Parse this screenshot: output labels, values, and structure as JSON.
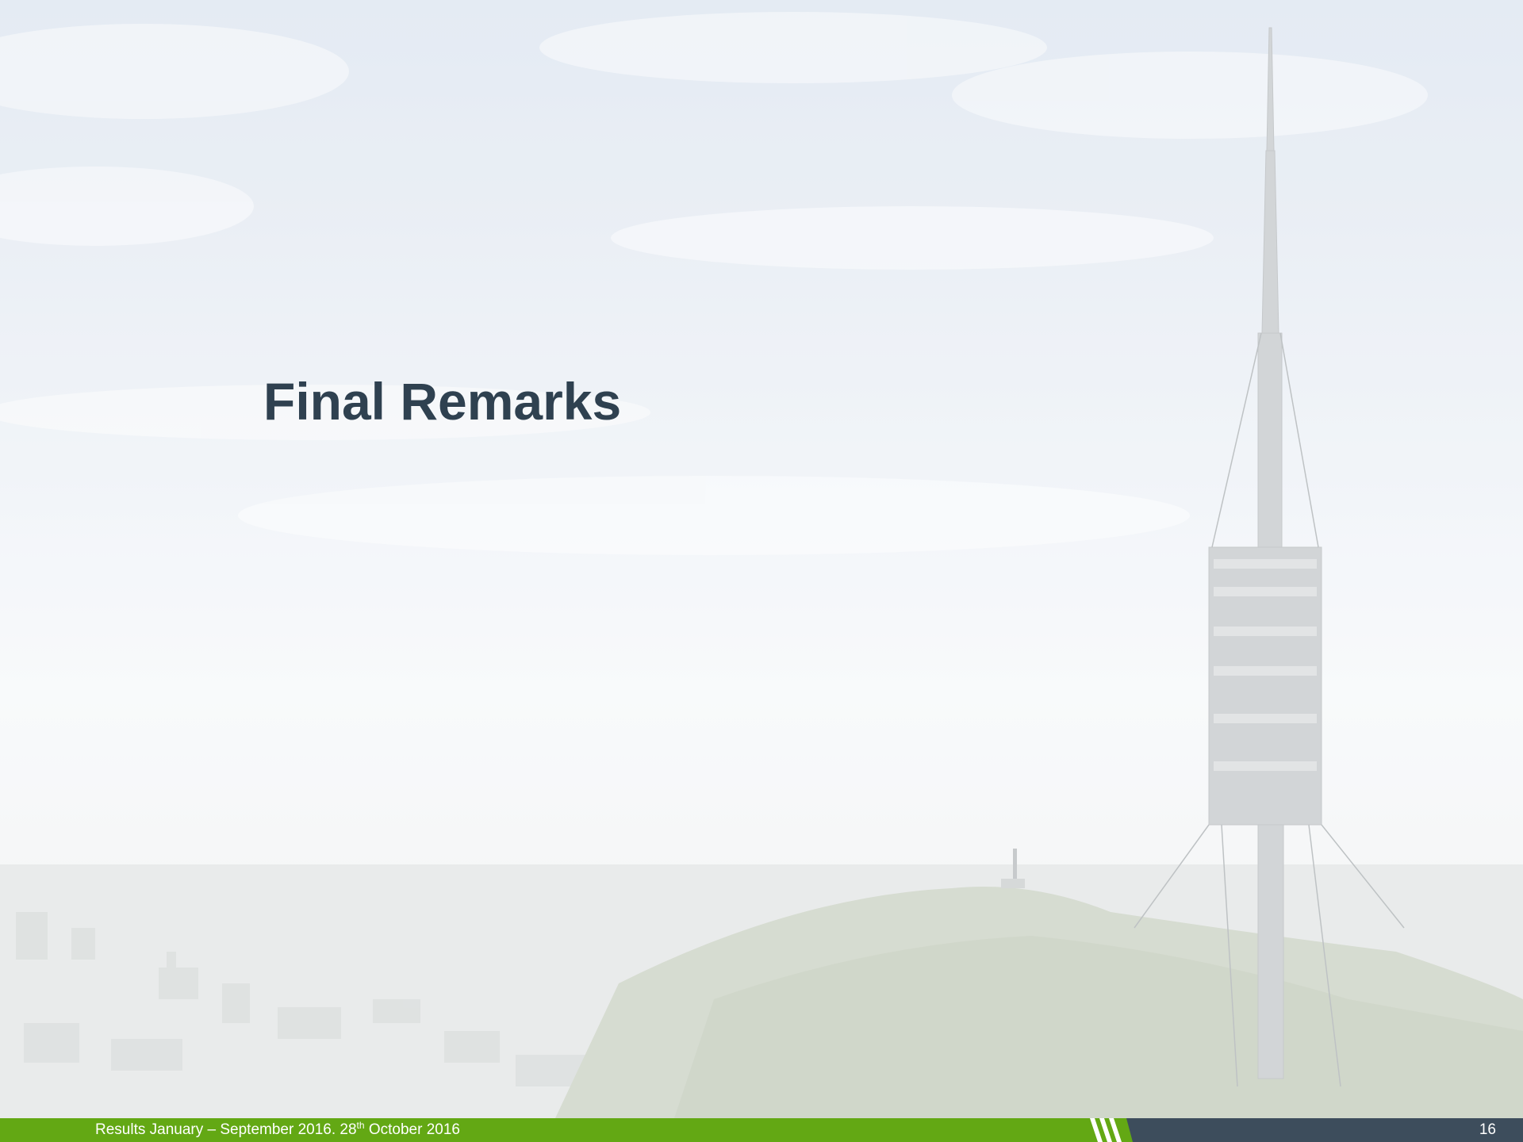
{
  "slide": {
    "title": "Final Remarks"
  },
  "footer": {
    "text_before_sup": "Results January – September 2016. 28",
    "sup": "th",
    "text_after_sup": " October 2016",
    "page_number": "16"
  },
  "colors": {
    "title": "#2f4150",
    "footer_green": "#63a814",
    "footer_dark": "#3d4d5c"
  },
  "background": {
    "icon": "telecom-tower-landscape-photo"
  }
}
